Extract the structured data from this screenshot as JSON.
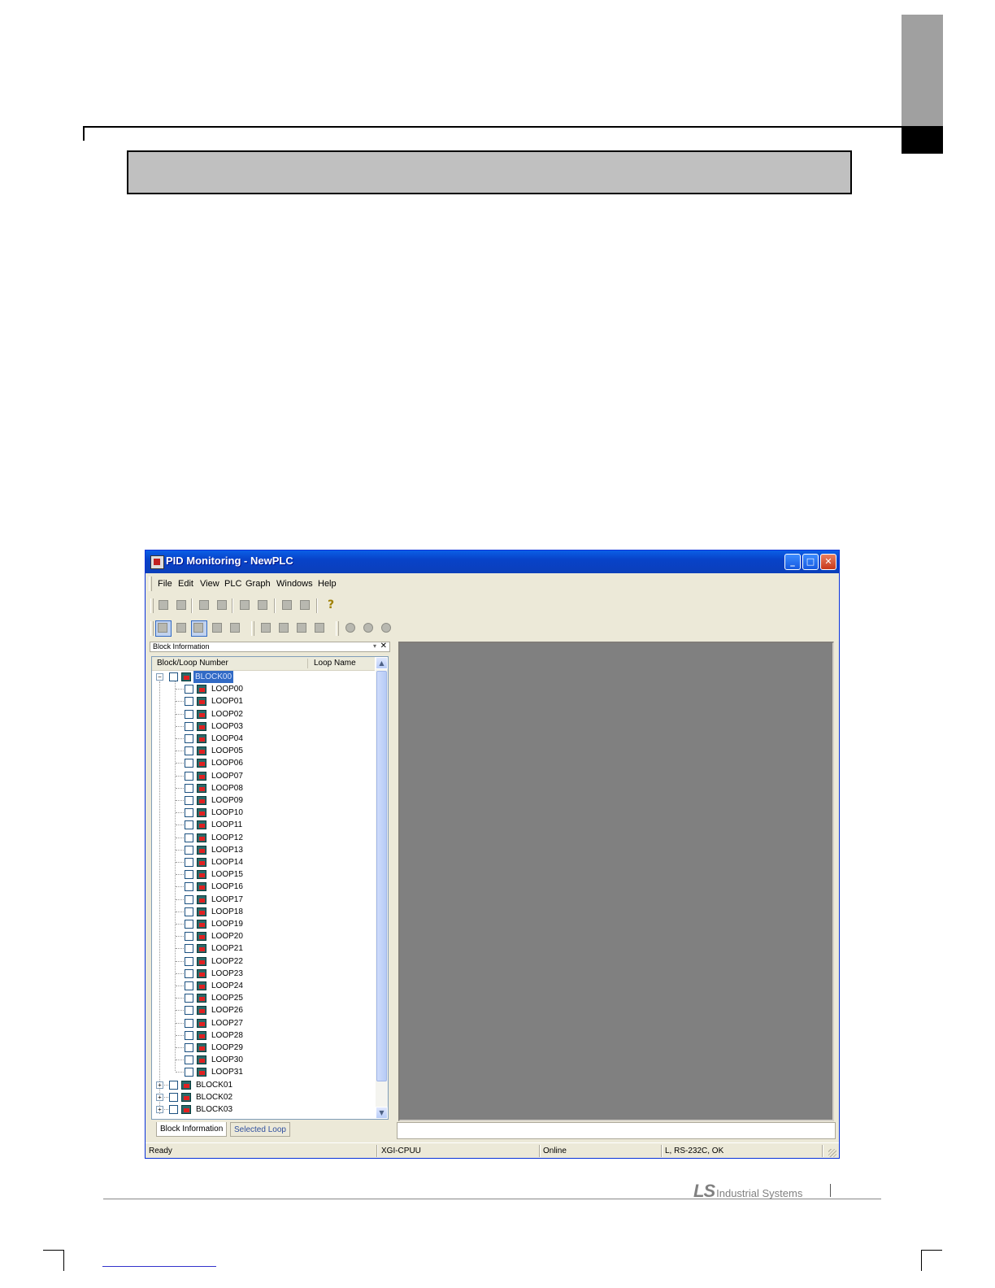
{
  "window": {
    "title": "PID Monitoring - NewPLC",
    "buttons": {
      "minimize": "_",
      "maximize": "□",
      "close": "✕"
    }
  },
  "menu": [
    "File",
    "Edit",
    "View",
    "PLC",
    "Graph",
    "Windows",
    "Help"
  ],
  "panel": {
    "title": "Block Information",
    "columns": {
      "block_loop_number": "Block/Loop Number",
      "loop_name": "Loop Name"
    },
    "tree": {
      "selected_block": "BLOCK00",
      "loops": [
        "LOOP00",
        "LOOP01",
        "LOOP02",
        "LOOP03",
        "LOOP04",
        "LOOP05",
        "LOOP06",
        "LOOP07",
        "LOOP08",
        "LOOP09",
        "LOOP10",
        "LOOP11",
        "LOOP12",
        "LOOP13",
        "LOOP14",
        "LOOP15",
        "LOOP16",
        "LOOP17",
        "LOOP18",
        "LOOP19",
        "LOOP20",
        "LOOP21",
        "LOOP22",
        "LOOP23",
        "LOOP24",
        "LOOP25",
        "LOOP26",
        "LOOP27",
        "LOOP28",
        "LOOP29",
        "LOOP30",
        "LOOP31"
      ],
      "other_blocks": [
        "BLOCK01",
        "BLOCK02",
        "BLOCK03"
      ]
    },
    "tabs": [
      "Block Information",
      "Selected Loop"
    ]
  },
  "status": {
    "state": "Ready",
    "cpu": "XGI-CPUU",
    "mode": "Online",
    "connection": "L, RS-232C, OK"
  },
  "footer": {
    "logo": "LS",
    "company": "Industrial Systems"
  },
  "icons": {
    "toolbar1": [
      "open-icon",
      "save-icon",
      "copy-icon",
      "paste-icon",
      "copy2-icon",
      "paste2-icon",
      "print-icon",
      "print-preview-icon",
      "help-icon"
    ],
    "toolbar2": [
      "monitor-icon",
      "monitor2-icon",
      "monitor-select-icon",
      "monitor3-icon",
      "monitor4-icon",
      "cascade-icon",
      "tile-horizontal-icon",
      "tile-vertical-icon",
      "arrange-icon",
      "zoom-in-icon",
      "zoom-out-icon",
      "zoom-reset-icon"
    ]
  },
  "colors": {
    "titlebar": "#0842c8",
    "selection": "#316ac5",
    "workspace": "#808080",
    "title_box": "#c0c0c0"
  }
}
